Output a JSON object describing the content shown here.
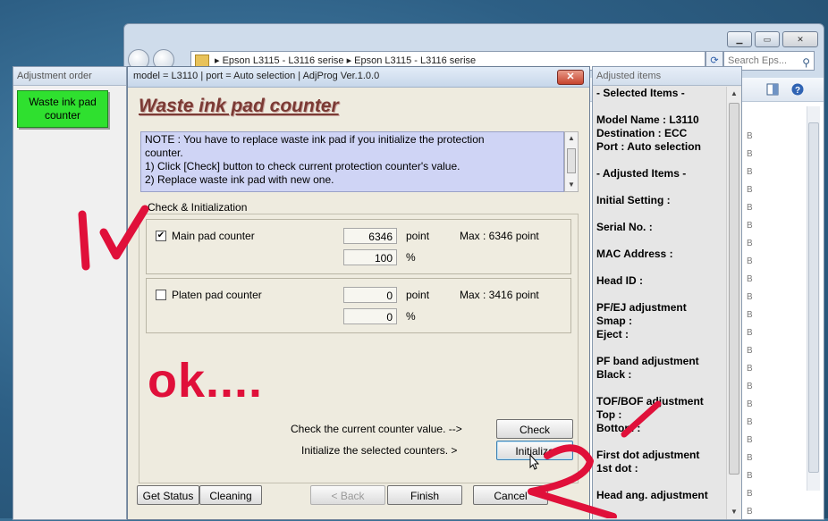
{
  "explorer": {
    "address_path": "▸  Epson L3115 - L3116 serise  ▸  Epson L3115 - L3116 serise",
    "search_placeholder": "Search Eps...",
    "file_sizes": [
      "B",
      "B",
      "B",
      "B",
      "B",
      "B",
      "B",
      "B",
      "B",
      "B",
      "B",
      "B",
      "B",
      "B",
      "B",
      "B",
      "B",
      "B",
      "B",
      "B",
      "B",
      "B"
    ]
  },
  "order_panel": {
    "title": "Adjustment order",
    "waste_ink_button": "Waste ink pad counter"
  },
  "items_panel": {
    "title": "Adjusted items",
    "lines": [
      "- Selected Items -",
      "",
      "Model Name : L3110",
      "Destination : ECC",
      "Port : Auto selection",
      "",
      "- Adjusted Items -",
      "",
      "Initial Setting :",
      "",
      "Serial No. :",
      "",
      "MAC Address :",
      "",
      "Head ID :",
      "",
      "PF/EJ adjustment",
      " Smap :",
      " Eject :",
      "",
      "PF band adjustment",
      " Black :",
      "",
      "TOF/BOF adjustment",
      " Top :",
      " Bottom :",
      "",
      "First dot adjustment",
      " 1st dot :",
      "",
      "Head ang. adjustment"
    ]
  },
  "dialog": {
    "title": "model = L3110 | port = Auto selection | AdjProg Ver.1.0.0",
    "close": "✕",
    "heading": "Waste ink pad counter",
    "note_lines": [
      "NOTE : You have to replace waste ink pad if you initialize the protection",
      "counter.",
      "1) Click [Check] button to check current protection counter's value.",
      "2) Replace waste ink pad with new one."
    ],
    "group_label": "Check & Initialization",
    "main_pad": {
      "checked": "✔",
      "label": "Main pad counter",
      "point_value": "6346",
      "point_unit": "point",
      "percent_value": "100",
      "percent_unit": "%",
      "max": "Max : 6346 point"
    },
    "platen_pad": {
      "checked": "",
      "label": "Platen pad counter",
      "point_value": "0",
      "point_unit": "point",
      "percent_value": "0",
      "percent_unit": "%",
      "max": "Max : 3416 point"
    },
    "overlay_text": "ok....",
    "check_prompt": "Check the current counter value.  -->",
    "check_button": "Check",
    "init_prompt": "Initialize the selected counters.   >",
    "init_button": "Initialize",
    "footer": {
      "get_status": "Get Status",
      "cleaning": "Cleaning",
      "back": "< Back",
      "finish": "Finish",
      "cancel": "Cancel"
    }
  },
  "annotation_colors": {
    "marker": "#e0103a"
  }
}
